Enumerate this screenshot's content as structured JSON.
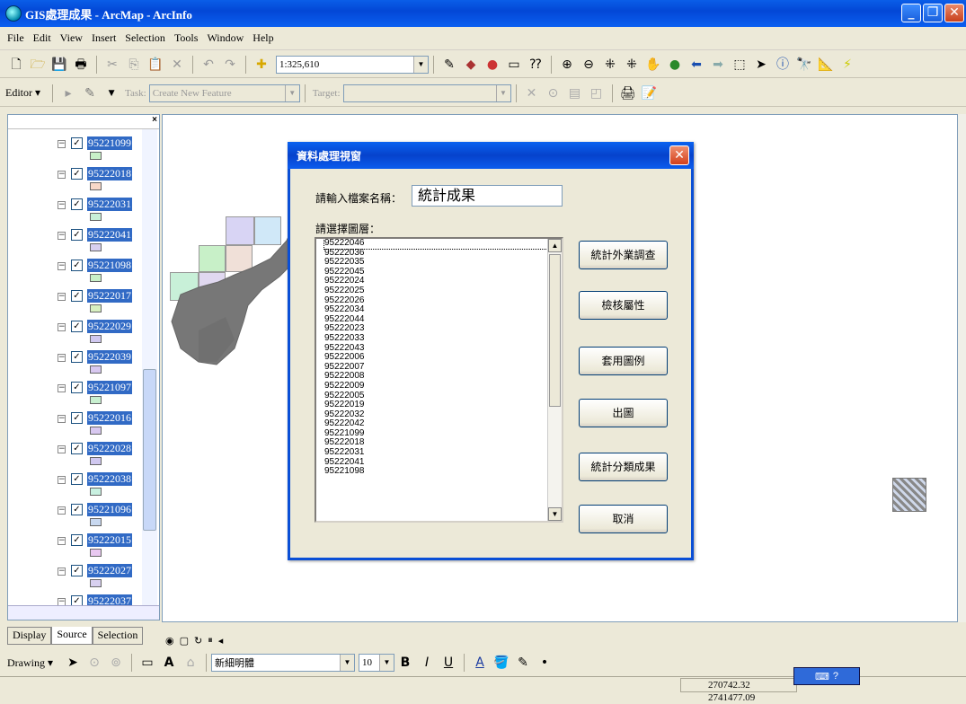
{
  "window": {
    "title": "GIS處理成果 - ArcMap - ArcInfo",
    "minimize": "_",
    "maximize": "❐",
    "close": "✕"
  },
  "menu": [
    "File",
    "Edit",
    "View",
    "Insert",
    "Selection",
    "Tools",
    "Window",
    "Help"
  ],
  "toolbar": {
    "scale": "1:325,610"
  },
  "editor": {
    "menu_label": "Editor ▾",
    "task_label": "Task:",
    "task_value": "Create New Feature",
    "target_label": "Target:"
  },
  "toc": {
    "layers": [
      {
        "name": "95221099",
        "color": "#c8f0c8"
      },
      {
        "name": "95222018",
        "color": "#f8d8c8"
      },
      {
        "name": "95222031",
        "color": "#c8f0d8"
      },
      {
        "name": "95222041",
        "color": "#d8d0f0"
      },
      {
        "name": "95221098",
        "color": "#c8f0c8"
      },
      {
        "name": "95222017",
        "color": "#d8f0c0"
      },
      {
        "name": "95222029",
        "color": "#d0c8f0"
      },
      {
        "name": "95222039",
        "color": "#d8c8f0"
      },
      {
        "name": "95221097",
        "color": "#c8f0d0"
      },
      {
        "name": "95222016",
        "color": "#d8c8f0"
      },
      {
        "name": "95222028",
        "color": "#d0c8f0"
      },
      {
        "name": "95222038",
        "color": "#c8f0e0"
      },
      {
        "name": "95221096",
        "color": "#c8d8f0"
      },
      {
        "name": "95222015",
        "color": "#e8c8f0"
      },
      {
        "name": "95222027",
        "color": "#d8d0f0"
      },
      {
        "name": "95222037",
        "color": "#d0d8f0"
      }
    ],
    "tabs": [
      "Display",
      "Source",
      "Selection"
    ]
  },
  "dialog": {
    "title": "資料處理視窗",
    "filename_label": "請輸入檔案名稱：",
    "filename_value": "統計成果",
    "layer_label": "請選擇圖層：",
    "layers": [
      "95222046",
      "95222036",
      "95222035",
      "95222045",
      "95222024",
      "95222025",
      "95222026",
      "95222034",
      "95222044",
      "95222023",
      "95222033",
      "95222043",
      "95222006",
      "95222007",
      "95222008",
      "95222009",
      "95222005",
      "95222019",
      "95222032",
      "95222042",
      "95221099",
      "95222018",
      "95222031",
      "95222041",
      "95221098"
    ],
    "buttons": [
      "統計外業調查",
      "檢核屬性",
      "套用圖例",
      "出圖",
      "統計分類成果",
      "取消"
    ]
  },
  "drawing": {
    "menu_label": "Drawing ▾",
    "font": "新細明體",
    "size": "10"
  },
  "status": {
    "coords": "270742.32  2741477.09"
  }
}
